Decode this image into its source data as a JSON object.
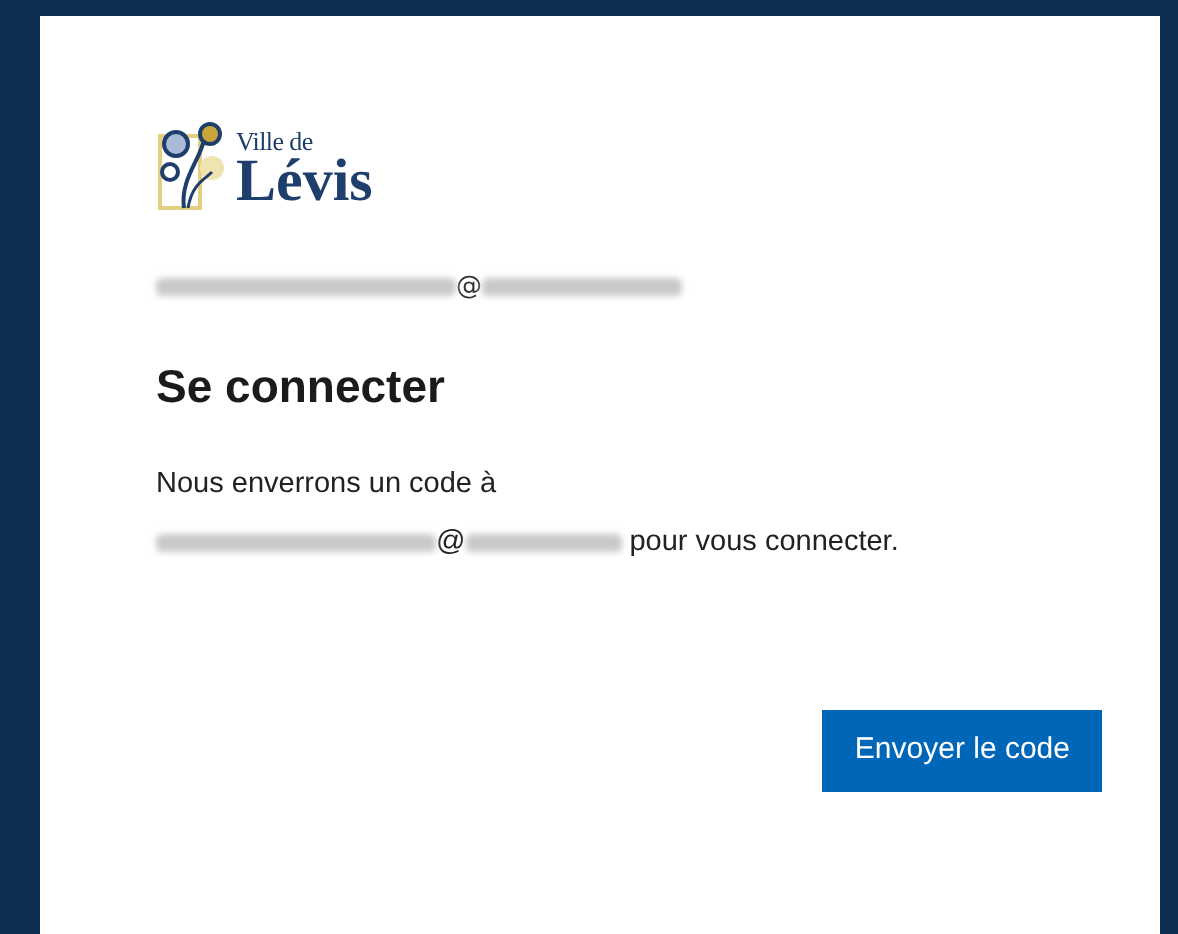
{
  "logo": {
    "line_1": "Ville de",
    "line_2": "Lévis"
  },
  "account": {
    "at_sign": "@"
  },
  "title": "Se connecter",
  "message": {
    "line_1": "Nous enverrons un code à",
    "at_sign": "@",
    "after": "pour vous connecter."
  },
  "buttons": [
    {
      "label": "Envoyer le code",
      "kind": "primary"
    }
  ]
}
